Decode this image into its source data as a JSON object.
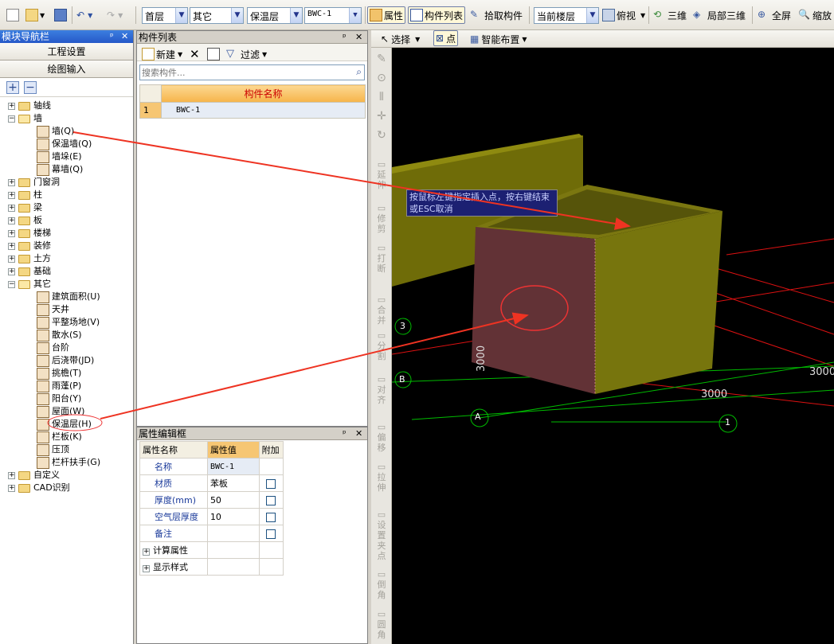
{
  "toolbar": {
    "floor": "首层",
    "category": "其它",
    "type": "保温层",
    "component": "BWC-1",
    "properties": "属性",
    "component_list": "构件列表",
    "pick_component": "拾取构件",
    "current_floor": "当前楼层",
    "top_view": "俯视",
    "three_d": "三维",
    "partial_3d": "局部三维",
    "fullscreen": "全屏",
    "zoom": "缩放"
  },
  "nav": {
    "title": "模块导航栏",
    "project_settings": "工程设置",
    "drawing_input": "绘图输入",
    "tree": [
      {
        "label": "轴线",
        "level": 0,
        "expander": "+"
      },
      {
        "label": "墙",
        "level": 0,
        "expander": "-"
      },
      {
        "label": "墙(Q)",
        "level": 1
      },
      {
        "label": "保温墙(Q)",
        "level": 1
      },
      {
        "label": "墙垛(E)",
        "level": 1
      },
      {
        "label": "幕墙(Q)",
        "level": 1
      },
      {
        "label": "门窗洞",
        "level": 0,
        "expander": "+"
      },
      {
        "label": "柱",
        "level": 0,
        "expander": "+"
      },
      {
        "label": "梁",
        "level": 0,
        "expander": "+"
      },
      {
        "label": "板",
        "level": 0,
        "expander": "+"
      },
      {
        "label": "楼梯",
        "level": 0,
        "expander": "+"
      },
      {
        "label": "装修",
        "level": 0,
        "expander": "+"
      },
      {
        "label": "土方",
        "level": 0,
        "expander": "+"
      },
      {
        "label": "基础",
        "level": 0,
        "expander": "+"
      },
      {
        "label": "其它",
        "level": 0,
        "expander": "-"
      },
      {
        "label": "建筑面积(U)",
        "level": 1
      },
      {
        "label": "天井",
        "level": 1
      },
      {
        "label": "平整场地(V)",
        "level": 1
      },
      {
        "label": "散水(S)",
        "level": 1
      },
      {
        "label": "台阶",
        "level": 1
      },
      {
        "label": "后浇带(JD)",
        "level": 1
      },
      {
        "label": "挑檐(T)",
        "level": 1
      },
      {
        "label": "雨蓬(P)",
        "level": 1
      },
      {
        "label": "阳台(Y)",
        "level": 1
      },
      {
        "label": "屋面(W)",
        "level": 1
      },
      {
        "label": "保温层(H)",
        "level": 1
      },
      {
        "label": "栏板(K)",
        "level": 1
      },
      {
        "label": "压顶",
        "level": 1
      },
      {
        "label": "栏杆扶手(G)",
        "level": 1
      },
      {
        "label": "自定义",
        "level": 0,
        "expander": "+"
      },
      {
        "label": "CAD识别",
        "level": 0,
        "expander": "+"
      }
    ]
  },
  "complist": {
    "title": "构件列表",
    "new": "新建",
    "filter": "过滤",
    "search_placeholder": "搜索构件...",
    "column": "构件名称",
    "rows": [
      {
        "index": "1",
        "name": "BWC-1"
      }
    ]
  },
  "propedit": {
    "title": "属性编辑框",
    "headers": [
      "属性名称",
      "属性值",
      "附加"
    ],
    "rows": [
      {
        "name": "名称",
        "value": "BWC-1",
        "check": false
      },
      {
        "name": "材质",
        "value": "苯板",
        "check": true
      },
      {
        "name": "厚度(mm)",
        "value": "50",
        "check": true
      },
      {
        "name": "空气层厚度",
        "value": "10",
        "check": true
      },
      {
        "name": "备注",
        "value": "",
        "check": true
      },
      {
        "name": "计算属性",
        "value": "",
        "expander": "+"
      },
      {
        "name": "显示样式",
        "value": "",
        "expander": "+"
      }
    ]
  },
  "viewtool": {
    "select": "选择",
    "point": "点",
    "smart_layout": "智能布置"
  },
  "sidebar": [
    "延伸",
    "修剪",
    "打断",
    "合并",
    "分割",
    "对齐",
    "偏移",
    "拉伸",
    "设置夹点",
    "倒角",
    "圆角"
  ],
  "view": {
    "tooltip": "按鼠标左键指定插入点，按右键结束或ESC取消",
    "dims": [
      "3000",
      "3000",
      "3000"
    ],
    "axis_labels": [
      "A",
      "B",
      "1",
      "3"
    ]
  }
}
